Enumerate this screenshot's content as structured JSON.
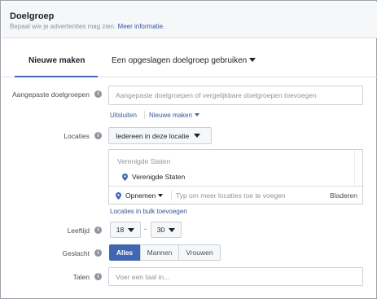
{
  "header": {
    "title": "Doelgroep",
    "subtitle": "Bepaal wie je advertenties mag zien.",
    "more_link": "Meer informatie."
  },
  "tabs": [
    {
      "label": "Nieuwe maken",
      "active": true
    },
    {
      "label": "Een opgeslagen doelgroep gebruiken",
      "active": false
    }
  ],
  "custom_audiences": {
    "label": "Aangepaste doelgroepen",
    "placeholder": "Aangepaste doelgroepen of vergelijkbare doelgroepen toevoegen",
    "exclude_link": "Uitsluiten",
    "create_new_link": "Nieuwe maken"
  },
  "locations": {
    "label": "Locaties",
    "dropdown_value": "Iedereen in deze locatie",
    "group_heading": "Verenigde Staten",
    "items": [
      "Verenigde Staten"
    ],
    "include_label": "Opnemen",
    "search_placeholder": "Typ om meer locaties toe te voegen",
    "browse_label": "Bladeren",
    "bulk_link": "Locaties in bulk toevoegen"
  },
  "age": {
    "label": "Leeftijd",
    "min": "18",
    "separator": "-",
    "max": "30"
  },
  "gender": {
    "label": "Geslacht",
    "options": [
      "Alles",
      "Mannen",
      "Vrouwen"
    ],
    "selected": "Alles"
  },
  "languages": {
    "label": "Talen",
    "placeholder": "Voer een taal in..."
  },
  "icons": {
    "info": "info-icon",
    "pin": "location-pin-icon",
    "caret": "caret-down-icon"
  },
  "colors": {
    "accent": "#4267b2",
    "link": "#365899"
  }
}
